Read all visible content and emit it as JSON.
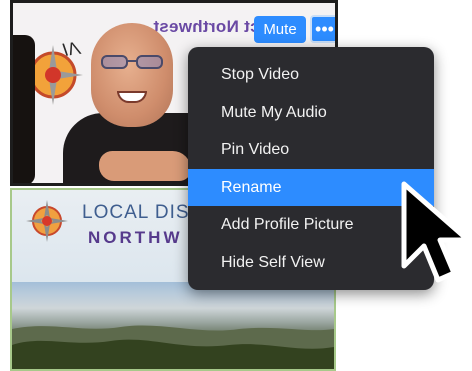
{
  "top_tile": {
    "background_text": "ct Northwest",
    "mute_label": "Mute",
    "more_label": "•••",
    "self_view": true
  },
  "bottom_tile": {
    "title": "LOCAL DIS",
    "subtitle": "NORTHW"
  },
  "context_menu": {
    "items": [
      {
        "label": "Stop Video",
        "selected": false
      },
      {
        "label": "Mute My Audio",
        "selected": false
      },
      {
        "label": "Pin Video",
        "selected": false
      },
      {
        "label": "Rename",
        "selected": true
      },
      {
        "label": "Add Profile Picture",
        "selected": false
      },
      {
        "label": "Hide Self View",
        "selected": false
      }
    ]
  },
  "colors": {
    "accent": "#2d8cff",
    "menu_background": "#2b2b2f",
    "menu_text": "#f2f2f2",
    "tile_border_active": "#1d1d1d",
    "tile_border_inactive": "#a7c98a"
  },
  "icons": {
    "more": "ellipsis-icon",
    "cursor": "mouse-pointer-icon"
  }
}
